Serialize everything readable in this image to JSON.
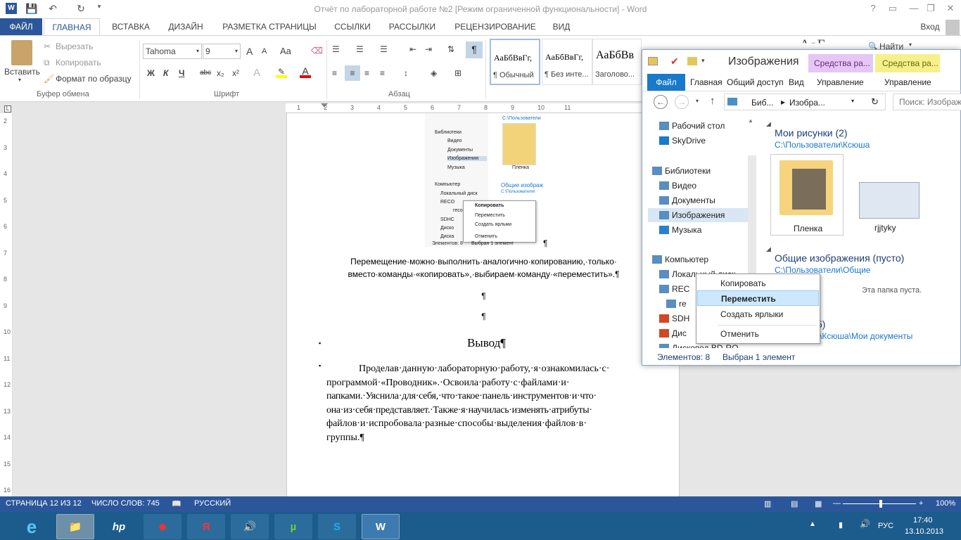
{
  "word": {
    "title": "Отчёт по лабораторной работе №2 [Режим ограниченной функциональности] - Word",
    "help": "?",
    "signin": "Вход",
    "tabs": [
      "ФАЙЛ",
      "ГЛАВНАЯ",
      "ВСТАВКА",
      "ДИЗАЙН",
      "РАЗМЕТКА СТРАНИЦЫ",
      "ССЫЛКИ",
      "РАССЫЛКИ",
      "РЕЦЕНЗИРОВАНИЕ",
      "ВИД"
    ],
    "clipboard": {
      "paste": "Вставить",
      "cut": "Вырезать",
      "copy": "Копировать",
      "format_painter": "Формат по образцу",
      "group": "Буфер обмена"
    },
    "font": {
      "name": "Tahoma",
      "size": "9",
      "group": "Шрифт",
      "bold": "Ж",
      "italic": "К",
      "underline": "Ч",
      "strike": "abc",
      "sub": "x₂",
      "sup": "x²",
      "case": "Aa",
      "grow": "A",
      "shrink": "A"
    },
    "paragraph": {
      "group": "Абзац",
      "pilcrow": "¶"
    },
    "styles": [
      {
        "sample": "АаБбВвГг,",
        "name": "¶ Обычный"
      },
      {
        "sample": "АаБбВвГг,",
        "name": "¶ Без инте..."
      },
      {
        "sample": "АаБбВв",
        "name": "Заголово..."
      }
    ],
    "find": "Найти",
    "styles_partial": "АаБ",
    "ruler_numbers": [
      "1",
      "2",
      "3",
      "4",
      "5",
      "6",
      "7",
      "8",
      "9",
      "10",
      "11"
    ],
    "vruler_numbers": [
      "2",
      "3",
      "4",
      "5",
      "6",
      "7",
      "8",
      "9",
      "10",
      "11",
      "12",
      "13",
      "14",
      "15",
      "16"
    ],
    "document": {
      "caption_line1": "Перемещение·можно·выполнить·аналогично·копированию,·только·",
      "caption_line2": "вместо·команды·«копировать»,·выбираем·команду·«переместить».¶",
      "pilcrow": "¶",
      "heading": "Вывод¶",
      "bullet": "▪",
      "conclusion": [
        "Проделав·данную·лабораторную·работу,·я·ознакомилась·с·",
        "программой·«Проводник».·Освоила·работу·с·файлами·и·",
        "папками.·Уяснила·для·себя,·что·такое·панель·инструментов·и·что·",
        "она·из·себя·представляет.·Также·я·научилась·изменять·атрибуты·",
        "файлов·и·испробовала·разные·способы·выделения·файлов·в·",
        "группы.¶"
      ],
      "embedded": {
        "nav": [
          "Библиотеки",
          "Видео",
          "Документы",
          "Изображения",
          "Музыка",
          "Компьютер",
          "Локальный диск",
          "RECO",
          "reco",
          "SDHC",
          "Диско",
          "Диска"
        ],
        "path": "C:\\Пользователи",
        "folder": "Пленка",
        "shared": "Общие изображ",
        "shared_path": "C:\\Пользователи\\",
        "menu": [
          "Копировать",
          "Переместить",
          "Создать ярлыки",
          "Отменить"
        ],
        "status_left": "Элементов: 8",
        "status_right": "Выбран 1 элемент"
      }
    },
    "status": {
      "page": "СТРАНИЦА 12 ИЗ 12",
      "words": "ЧИСЛО СЛОВ: 745",
      "lang": "РУССКИЙ",
      "zoom": "100%"
    }
  },
  "explorer": {
    "title": "Изображения",
    "tool_tabs": [
      "Средства ра...",
      "Средства ра..."
    ],
    "ribbon_tabs": [
      "Файл",
      "Главная",
      "Общий доступ",
      "Вид",
      "Управление",
      "Управление"
    ],
    "address": [
      "Биб...",
      "Изобра..."
    ],
    "search_placeholder": "Поиск: Изображ",
    "nav": [
      {
        "label": "Рабочий стол",
        "icon": "desktop-icon"
      },
      {
        "label": "SkyDrive",
        "icon": "cloud-icon"
      },
      {
        "label": "Библиотеки",
        "icon": "library-icon"
      },
      {
        "label": "Видео",
        "icon": "video-icon"
      },
      {
        "label": "Документы",
        "icon": "documents-icon"
      },
      {
        "label": "Изображения",
        "icon": "pictures-icon",
        "selected": true
      },
      {
        "label": "Музыка",
        "icon": "music-icon"
      },
      {
        "label": "Компьютер",
        "icon": "computer-icon"
      },
      {
        "label": "Локальный диск",
        "icon": "drive-icon"
      },
      {
        "label": "REC",
        "icon": "drive-icon"
      },
      {
        "label": "re",
        "icon": "drive-icon"
      },
      {
        "label": "SDH",
        "icon": "sd-icon"
      },
      {
        "label": "Дис",
        "icon": "office-icon"
      },
      {
        "label": "Дисковод BD-RO",
        "icon": "bd-icon"
      }
    ],
    "groups": [
      {
        "title": "Мои рисунки (2)",
        "path": "C:\\Пользователи\\Ксюша"
      },
      {
        "title": "Общие изображения (пусто)",
        "path": "C:\\Пользователи\\Общие"
      },
      {
        "title": "5)",
        "path": "\\Ксюша\\Мои документы"
      }
    ],
    "items": [
      "Пленка",
      "rjjtyky"
    ],
    "empty": "Эта папка пуста.",
    "context_menu": [
      "Копировать",
      "Переместить",
      "Создать ярлыки",
      "Отменить"
    ],
    "status_items": "Элементов: 8",
    "status_selected": "Выбран 1 элемент"
  },
  "taskbar": {
    "apps": [
      "e",
      "📁",
      "hp",
      "●",
      "Я",
      "🔊",
      "µ",
      "S",
      "W"
    ],
    "lang": "РУС",
    "time": "17:40",
    "date": "13.10.2013"
  },
  "colors": {
    "word_blue": "#2b579a",
    "taskbar": "#1c5c8c",
    "explorer_accent": "#1979ca"
  }
}
